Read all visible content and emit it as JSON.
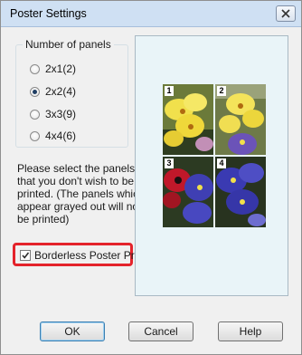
{
  "window": {
    "title": "Poster Settings"
  },
  "panels_group": {
    "legend": "Number of panels",
    "options": [
      {
        "label": "2x1(2)",
        "selected": false
      },
      {
        "label": "2x2(4)",
        "selected": true
      },
      {
        "label": "3x3(9)",
        "selected": false
      },
      {
        "label": "4x4(6)",
        "selected": false
      }
    ]
  },
  "instructions": {
    "lines": [
      "Please select the panels",
      "that you don't wish to be",
      "printed. (The panels which",
      "appear grayed out will not",
      "be printed)"
    ]
  },
  "borderless": {
    "label": "Borderless Poster Print",
    "checked": true,
    "highlight_color": "#e4232b"
  },
  "preview": {
    "panel_labels": [
      "1",
      "2",
      "3",
      "4"
    ],
    "background": "#e9f4f8"
  },
  "buttons": {
    "ok": "OK",
    "cancel": "Cancel",
    "help": "Help"
  }
}
